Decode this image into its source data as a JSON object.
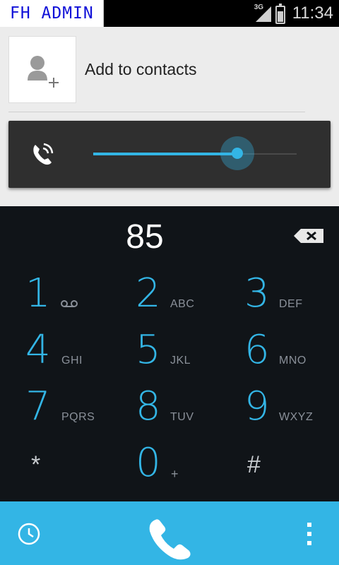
{
  "status_bar": {
    "app_badge": "FH ADMIN",
    "network_label": "3G",
    "time": "11:34"
  },
  "contact": {
    "add_label": "Add to contacts",
    "icon": "add-contact-icon"
  },
  "volume": {
    "icon": "in-call-volume-icon",
    "level": 0.71,
    "accent": "#33b5e5"
  },
  "dialer": {
    "digits": "85",
    "backspace_icon": "backspace-icon",
    "keys": [
      {
        "num": "1",
        "sub": "",
        "icon": "voicemail-icon"
      },
      {
        "num": "2",
        "sub": "ABC"
      },
      {
        "num": "3",
        "sub": "DEF"
      },
      {
        "num": "4",
        "sub": "GHI"
      },
      {
        "num": "5",
        "sub": "JKL"
      },
      {
        "num": "6",
        "sub": "MNO"
      },
      {
        "num": "7",
        "sub": "PQRS"
      },
      {
        "num": "8",
        "sub": "TUV"
      },
      {
        "num": "9",
        "sub": "WXYZ"
      },
      {
        "num": "*",
        "sub": ""
      },
      {
        "num": "0",
        "sub": "+"
      },
      {
        "num": "#",
        "sub": ""
      }
    ]
  },
  "action_bar": {
    "history_icon": "call-history-icon",
    "call_icon": "phone-call-icon",
    "menu_icon": "overflow-menu-icon",
    "color": "#33b5e5"
  }
}
